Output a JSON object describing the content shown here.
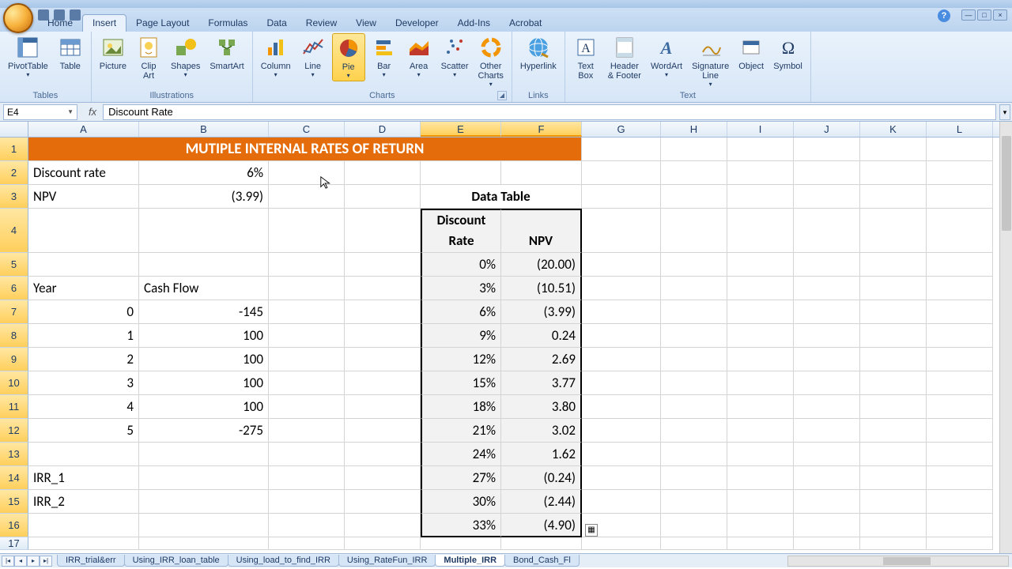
{
  "tabs": [
    "Home",
    "Insert",
    "Page Layout",
    "Formulas",
    "Data",
    "Review",
    "View",
    "Developer",
    "Add-Ins",
    "Acrobat"
  ],
  "active_tab": 1,
  "ribbon": {
    "tables": {
      "label": "Tables",
      "items": [
        {
          "name": "pivottable",
          "label": "PivotTable",
          "dd": true
        },
        {
          "name": "table",
          "label": "Table"
        }
      ]
    },
    "illustrations": {
      "label": "Illustrations",
      "items": [
        {
          "name": "picture",
          "label": "Picture"
        },
        {
          "name": "clipart",
          "label": "Clip\nArt"
        },
        {
          "name": "shapes",
          "label": "Shapes",
          "dd": true
        },
        {
          "name": "smartart",
          "label": "SmartArt"
        }
      ]
    },
    "charts": {
      "label": "Charts",
      "items": [
        {
          "name": "column",
          "label": "Column",
          "dd": true
        },
        {
          "name": "line",
          "label": "Line",
          "dd": true
        },
        {
          "name": "pie",
          "label": "Pie",
          "dd": true,
          "highlight": true
        },
        {
          "name": "bar",
          "label": "Bar",
          "dd": true
        },
        {
          "name": "area",
          "label": "Area",
          "dd": true
        },
        {
          "name": "scatter",
          "label": "Scatter",
          "dd": true
        },
        {
          "name": "other",
          "label": "Other\nCharts",
          "dd": true
        }
      ]
    },
    "links": {
      "label": "Links",
      "items": [
        {
          "name": "hyperlink",
          "label": "Hyperlink"
        }
      ]
    },
    "text": {
      "label": "Text",
      "items": [
        {
          "name": "textbox",
          "label": "Text\nBox"
        },
        {
          "name": "headerfooter",
          "label": "Header\n& Footer"
        },
        {
          "name": "wordart",
          "label": "WordArt",
          "dd": true
        },
        {
          "name": "sigline",
          "label": "Signature\nLine",
          "dd": true
        },
        {
          "name": "object",
          "label": "Object"
        },
        {
          "name": "symbol",
          "label": "Symbol"
        }
      ]
    }
  },
  "namebox": "E4",
  "formula": "Discount Rate",
  "col_widths": {
    "A": 140,
    "B": 164,
    "C": 96,
    "D": 96,
    "E": 102,
    "F": 102,
    "G": 100,
    "H": 84,
    "I": 84,
    "J": 84,
    "K": 84,
    "L": 84
  },
  "columns": [
    "A",
    "B",
    "C",
    "D",
    "E",
    "F",
    "G",
    "H",
    "I",
    "J",
    "K",
    "L"
  ],
  "cells": {
    "title": "MUTIPLE INTERNAL RATES OF RETURN",
    "A2": "Discount rate",
    "B2": "6%",
    "A3": "NPV",
    "B3": "(3.99)",
    "EF3": "Data Table",
    "E4a": "Discount",
    "E4b": "Rate",
    "F4": "NPV",
    "A6": "Year",
    "B6": "Cash Flow",
    "A7": "0",
    "B7": "-145",
    "A8": "1",
    "B8": "100",
    "A9": "2",
    "B9": "100",
    "A10": "3",
    "B10": "100",
    "A11": "4",
    "B11": "100",
    "A12": "5",
    "B12": "-275",
    "A14": "IRR_1",
    "A15": "IRR_2",
    "dt": [
      {
        "r": "0%",
        "n": "(20.00)"
      },
      {
        "r": "3%",
        "n": "(10.51)"
      },
      {
        "r": "6%",
        "n": "(3.99)"
      },
      {
        "r": "9%",
        "n": "0.24"
      },
      {
        "r": "12%",
        "n": "2.69"
      },
      {
        "r": "15%",
        "n": "3.77"
      },
      {
        "r": "18%",
        "n": "3.80"
      },
      {
        "r": "21%",
        "n": "3.02"
      },
      {
        "r": "24%",
        "n": "1.62"
      },
      {
        "r": "27%",
        "n": "(0.24)"
      },
      {
        "r": "30%",
        "n": "(2.44)"
      },
      {
        "r": "33%",
        "n": "(4.90)"
      }
    ]
  },
  "sheets": [
    "IRR_trial&err",
    "Using_IRR_loan_table",
    "Using_load_to_find_IRR",
    "Using_RateFun_IRR",
    "Multiple_IRR",
    "Bond_Cash_Fl"
  ],
  "active_sheet": 4,
  "chart_data": {
    "type": "table",
    "title": "MUTIPLE INTERNAL RATES OF RETURN",
    "inputs": {
      "discount_rate": 0.06,
      "npv": -3.99
    },
    "cash_flows": {
      "year": [
        0,
        1,
        2,
        3,
        4,
        5
      ],
      "cf": [
        -145,
        100,
        100,
        100,
        100,
        -275
      ]
    },
    "data_table": {
      "discount_rate": [
        0,
        0.03,
        0.06,
        0.09,
        0.12,
        0.15,
        0.18,
        0.21,
        0.24,
        0.27,
        0.3,
        0.33
      ],
      "npv": [
        -20.0,
        -10.51,
        -3.99,
        0.24,
        2.69,
        3.77,
        3.8,
        3.02,
        1.62,
        -0.24,
        -2.44,
        -4.9
      ]
    }
  }
}
